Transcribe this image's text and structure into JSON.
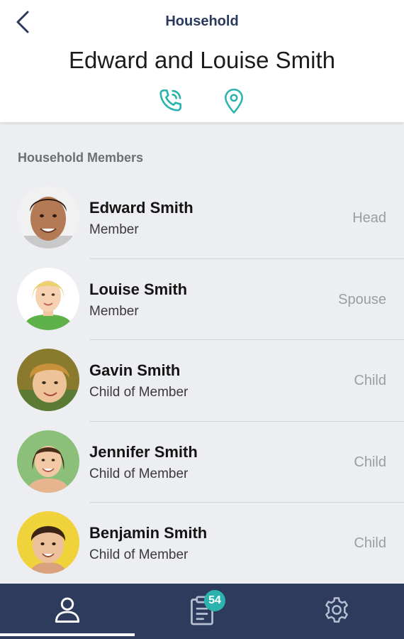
{
  "header": {
    "title": "Household",
    "household_name": "Edward and Louise Smith",
    "icons": {
      "back": "chevron-left-icon",
      "phone": "phone-icon",
      "location": "location-pin-icon"
    },
    "accent_color": "#2bb3ad"
  },
  "members_section": {
    "heading": "Household Members",
    "members": [
      {
        "name": "Edward Smith",
        "type": "Member",
        "role": "Head"
      },
      {
        "name": "Louise Smith",
        "type": "Member",
        "role": "Spouse"
      },
      {
        "name": "Gavin Smith",
        "type": "Child of Member",
        "role": "Child"
      },
      {
        "name": "Jennifer Smith",
        "type": "Child of Member",
        "role": "Child"
      },
      {
        "name": "Benjamin Smith",
        "type": "Child of Member",
        "role": "Child"
      }
    ]
  },
  "tab_bar": {
    "background_color": "#2d3b5c",
    "tabs": [
      {
        "icon": "person-icon",
        "active": true
      },
      {
        "icon": "clipboard-icon",
        "badge": "54"
      },
      {
        "icon": "gear-icon"
      }
    ]
  }
}
